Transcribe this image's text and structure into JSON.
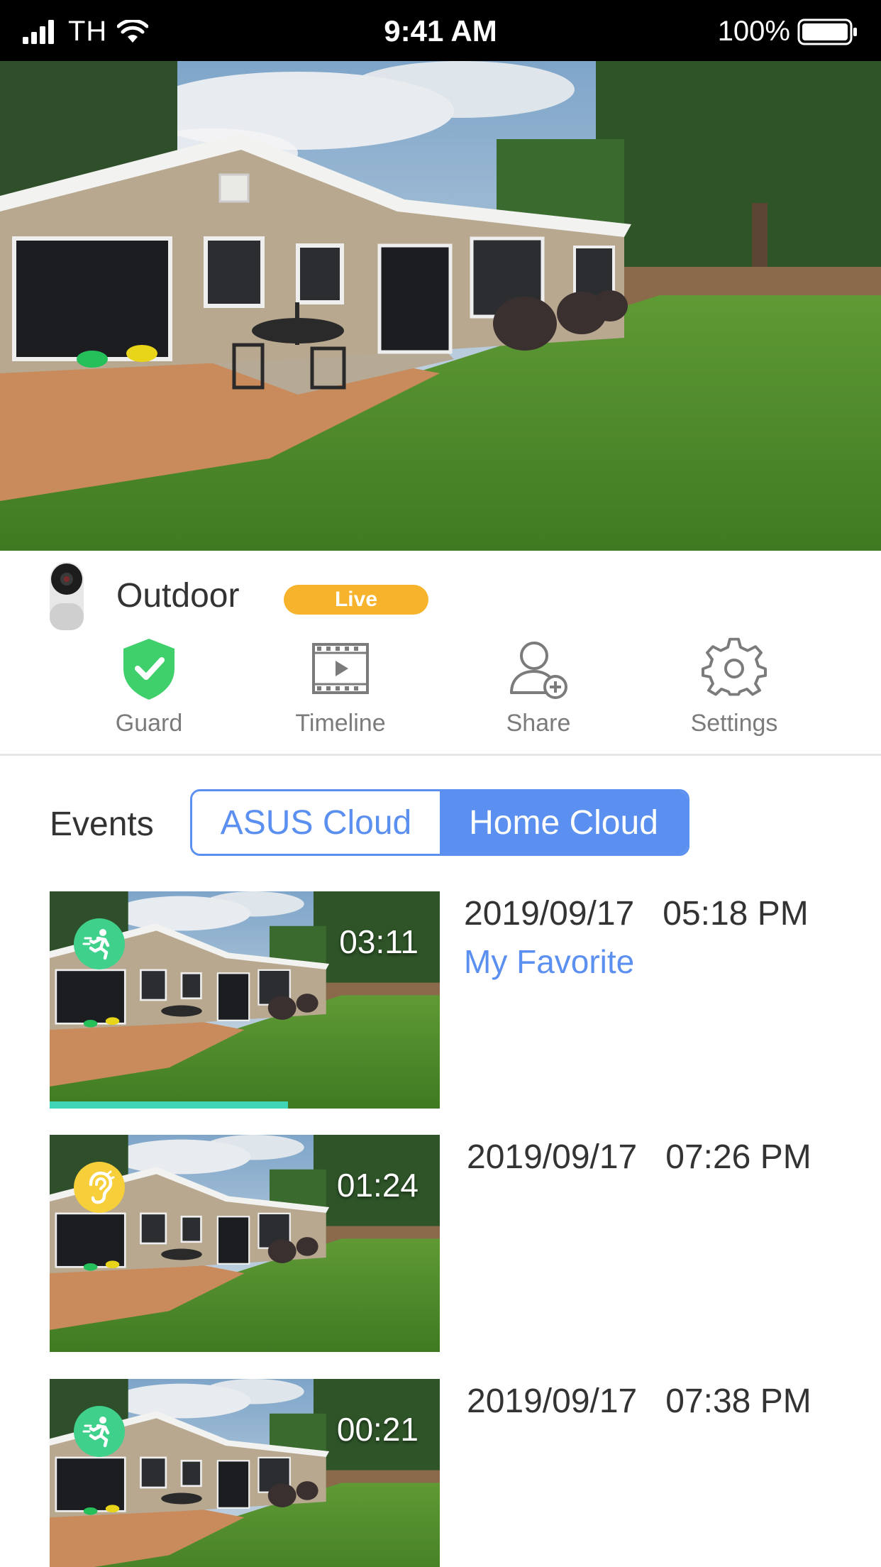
{
  "status_bar": {
    "carrier": "TH",
    "time": "9:41 AM",
    "battery": "100%"
  },
  "camera": {
    "name": "Outdoor",
    "live_label": "Live"
  },
  "actions": {
    "guard": "Guard",
    "timeline": "Timeline",
    "share": "Share",
    "settings": "Settings"
  },
  "events": {
    "label": "Events",
    "tabs": [
      "ASUS Cloud",
      "Home Cloud"
    ],
    "active_tab": "Home Cloud",
    "items": [
      {
        "date": "2019/09/17",
        "time": "05:18 PM",
        "duration": "03:11",
        "type": "motion-icon",
        "tag": "My Favorite",
        "progress": 0.61
      },
      {
        "date": "2019/09/17",
        "time": "07:26 PM",
        "duration": "01:24",
        "type": "sound-icon",
        "tag": ""
      },
      {
        "date": "2019/09/17",
        "time": "07:38 PM",
        "duration": "00:21",
        "type": "motion-icon",
        "tag": ""
      }
    ]
  },
  "colors": {
    "accent": "#5b8ff0",
    "live": "#f7b32b",
    "guard": "#3fd06b",
    "motion": "#3fd08b",
    "sound": "#f6cf3a",
    "progress": "#3fd6b8"
  }
}
